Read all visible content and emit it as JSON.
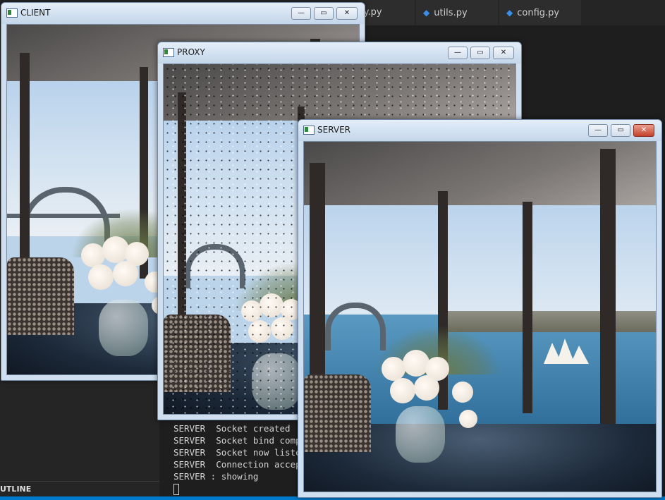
{
  "editor": {
    "tabs": [
      {
        "label": "xy.py",
        "icon": "python-file-icon"
      },
      {
        "label": "utils.py",
        "icon": "python-file-icon"
      },
      {
        "label": "config.py",
        "icon": "python-file-icon"
      }
    ],
    "outline_label": "UTLINE"
  },
  "terminal": {
    "lines": [
      "SERVER  Socket created",
      "SERVER  Socket bind compl",
      "SERVER  Socket now listen",
      "SERVER  Connection accept",
      "SERVER : showing"
    ]
  },
  "windows": {
    "client": {
      "title": "CLIENT"
    },
    "proxy": {
      "title": "PROXY"
    },
    "server": {
      "title": "SERVER"
    }
  },
  "window_buttons": {
    "minimize": "—",
    "maximize": "▭",
    "close": "✕"
  },
  "colors": {
    "accent": "#007acc",
    "close_active": "#c4412b"
  }
}
